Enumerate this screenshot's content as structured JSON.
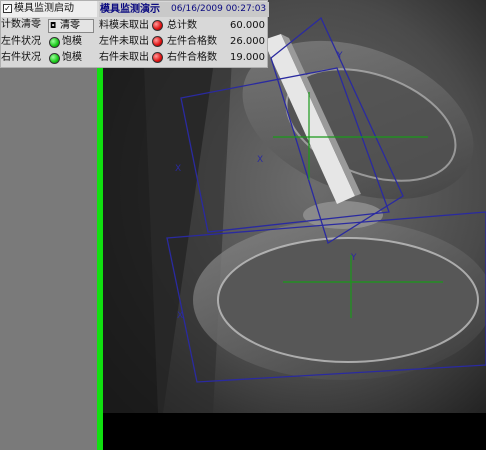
{
  "panel": {
    "monitor_start_label": "模具监测启动",
    "monitor_start_checked": true,
    "count_reset_label": "计数清零",
    "reset_button_label": "清零",
    "left_status_label": "左件状况",
    "left_status_value": "饱模",
    "right_status_label": "右件状况",
    "right_status_value": "饱模"
  },
  "header": {
    "title": "模具监测演示",
    "datetime": "06/16/2009 00:27:03"
  },
  "stats": [
    {
      "label": "料模未取出",
      "counter_label": "总计数",
      "value": "60.000"
    },
    {
      "label": "左件未取出",
      "counter_label": "左件合格数",
      "value": "26.000"
    },
    {
      "label": "右件未取出",
      "counter_label": "右件合格数",
      "value": "19.000"
    }
  ],
  "overlay_labels": {
    "x1": "X",
    "y1": "Y",
    "x2": "X",
    "y2": "Y",
    "x3": "X"
  },
  "colors": {
    "status_ok": "#18c818",
    "status_alarm": "#e01010",
    "roi_box": "#2a2aa0",
    "crosshair": "#1a9a1a",
    "frame_bar": "#10e010"
  }
}
